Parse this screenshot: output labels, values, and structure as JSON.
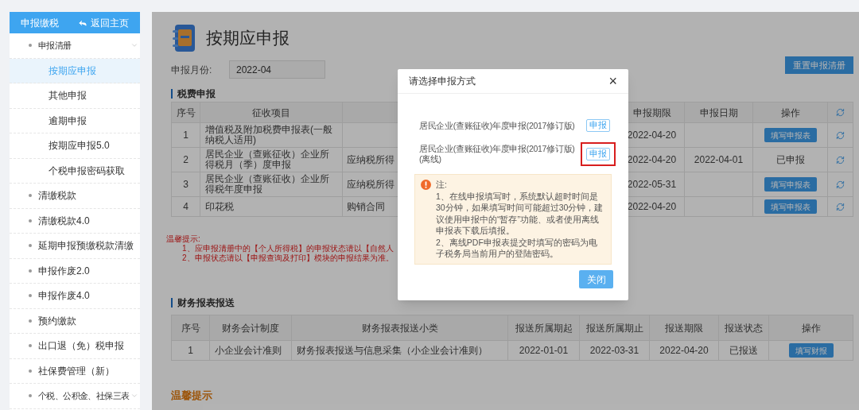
{
  "sidebar": {
    "title": "申报缴税",
    "back_label": "返回主页",
    "items": [
      {
        "label": "申报清册",
        "selected": false,
        "kind": "group",
        "children": [
          {
            "label": "按期应申报",
            "selected": true
          },
          {
            "label": "其他申报",
            "selected": false
          },
          {
            "label": "逾期申报",
            "selected": false
          },
          {
            "label": "按期应申报5.0",
            "selected": false
          },
          {
            "label": "个税申报密码获取",
            "selected": false
          }
        ]
      },
      {
        "label": "清缴税款",
        "selected": false
      },
      {
        "label": "清缴税款4.0",
        "selected": false
      },
      {
        "label": "延期申报预缴税款清缴",
        "selected": false
      },
      {
        "label": "申报作废2.0",
        "selected": false
      },
      {
        "label": "申报作废4.0",
        "selected": false
      },
      {
        "label": "预约缴款",
        "selected": false
      },
      {
        "label": "出口退（免）税申报",
        "selected": false
      },
      {
        "label": "社保费管理（新）",
        "selected": false
      },
      {
        "label": "个税、公积金、社保三表",
        "selected": false,
        "kind": "group"
      }
    ]
  },
  "page": {
    "title": "按期应申报",
    "month_label": "申报月份:",
    "month_value": "2022-04",
    "reset_button": "重置申报清册"
  },
  "tax_section": {
    "heading": "税费申报",
    "columns_left": [
      "序号",
      "征收项目"
    ],
    "columns_right": [
      "申报期限",
      "申报日期",
      "操作"
    ],
    "rows": [
      {
        "number": "1",
        "item": "增值税及附加税费申报表(一般纳税人适用)",
        "deadline": "2022-04-20",
        "action": {
          "kind": "button",
          "label": "填写申报表"
        }
      },
      {
        "number": "2",
        "item": "居民企业（查账征收）企业所得税月（季）度申报",
        "column_3": "应纳税所得",
        "deadline": "2022-04-20",
        "filed_date": "2022-04-01",
        "action": {
          "kind": "text",
          "label": "已申报"
        }
      },
      {
        "number": "3",
        "item": "居民企业（查账征收）企业所得税年度申报",
        "column_3": "应纳税所得",
        "deadline": "2022-05-31",
        "action": {
          "kind": "button",
          "label": "填写申报表"
        }
      },
      {
        "number": "4",
        "item": "印花税",
        "column_3": "购销合同",
        "deadline": "2022-04-20",
        "action": {
          "kind": "button",
          "label": "填写申报表"
        }
      }
    ],
    "hint_title": "温馨提示:",
    "hints": [
      "1、应申报清册中的【个人所得税】的申报状态请以【自然人",
      "2、申报状态请以【申报查询及打印】模块的申报结果为准。"
    ]
  },
  "report_section": {
    "heading": "财务报表报送",
    "columns": [
      "序号",
      "财务会计制度",
      "财务报表报送小类",
      "报送所属期起",
      "报送所属期止",
      "报送期限",
      "报送状态",
      "操作"
    ],
    "rows": [
      {
        "cells": [
          "1",
          "小企业会计准则",
          "财务报表报送与信息采集（小企业会计准则）",
          "2022-01-01",
          "2022-03-31",
          "2022-04-20",
          "已报送"
        ],
        "action": "填写财报"
      }
    ]
  },
  "bottom_heading": "温馨提示",
  "dialog": {
    "title": "请选择申报方式",
    "close": "×",
    "options": [
      {
        "label": "居民企业(查账征收)年度申报(2017修订版)",
        "button": "申报",
        "highlighted": false
      },
      {
        "label": "居民企业(查账征收)年度申报(2017修订版)(离线)",
        "button": "申报",
        "highlighted": true
      }
    ],
    "notice": {
      "heading": "注:",
      "lines": [
        "1、在线申报填写时，系统默认超时时间是30分钟，如果填写时间可能超过30分钟，建议使用申报中的“暂存”功能、或者使用离线申报表下载后填报。",
        "2、离线PDF申报表提交时填写的密码为电子税务局当前用户的登陆密码。"
      ]
    },
    "close_button": "关闭"
  }
}
